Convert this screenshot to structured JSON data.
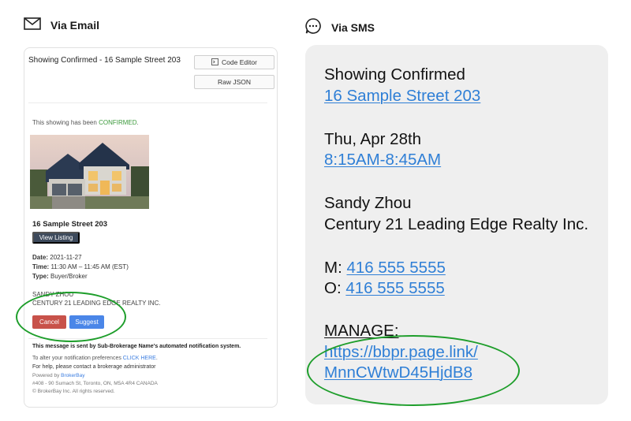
{
  "email_header": {
    "icon": "mail-icon",
    "label": "Via Email"
  },
  "sms_header": {
    "icon": "chat-bubble-icon",
    "label": "Via SMS"
  },
  "email": {
    "subject": "Showing Confirmed - 16 Sample Street 203",
    "code_editor_label": "Code Editor",
    "raw_json_label": "Raw JSON",
    "intro_prefix": "This showing has been ",
    "intro_status": "CONFIRMED",
    "intro_suffix": ".",
    "listing_title": "16 Sample Street 203",
    "view_listing_label": "View Listing",
    "date_label": "Date:",
    "date_value": "2021-11-27",
    "time_label": "Time:",
    "time_value": "11:30 AM – 11:45 AM (EST)",
    "type_label": "Type:",
    "type_value": "Buyer/Broker",
    "agent_name": "SANDY ZHOU",
    "agent_brokerage": "CENTURY 21 LEADING EDGE REALTY INC.",
    "cancel_label": "Cancel",
    "suggest_label": "Suggest",
    "footer_bold": "This message is sent by Sub-Brokerage Name's automated notification system.",
    "footer_pref_prefix": "To alter your notification preferences ",
    "footer_pref_link": "CLICK HERE",
    "footer_pref_suffix": ".",
    "footer_help": "For help, please contact a brokerage administrator",
    "powered_prefix": "Powered by ",
    "powered_link": "BrokerBay",
    "address": "#408 - 90 Sumach St, Toronto, ON, M5A 4R4 CANADA",
    "copyright": "© BrokerBay Inc. All rights reserved."
  },
  "sms": {
    "title": "Showing Confirmed",
    "address_link": "16 Sample Street 203",
    "date": "Thu, Apr 28th",
    "time_link": "8:15AM-8:45AM",
    "agent_name": "Sandy Zhou",
    "brokerage": "Century 21 Leading Edge Realty Inc.",
    "mobile_label": "M: ",
    "mobile_link": "416 555 5555",
    "office_label": "O: ",
    "office_link": "416 555 5555",
    "manage_label": "MANAGE:",
    "manage_link_line1": "https://bbpr.page.link/",
    "manage_link_line2": "MnnCWtwD45HjdB8"
  },
  "colors": {
    "confirmed_green": "#3c9a3c",
    "link_blue": "#2f7fd6",
    "cancel_red": "#c8524a",
    "suggest_blue": "#4a86e8",
    "annotation_green": "#1e9e2b",
    "sms_bubble_bg": "#efefef"
  }
}
